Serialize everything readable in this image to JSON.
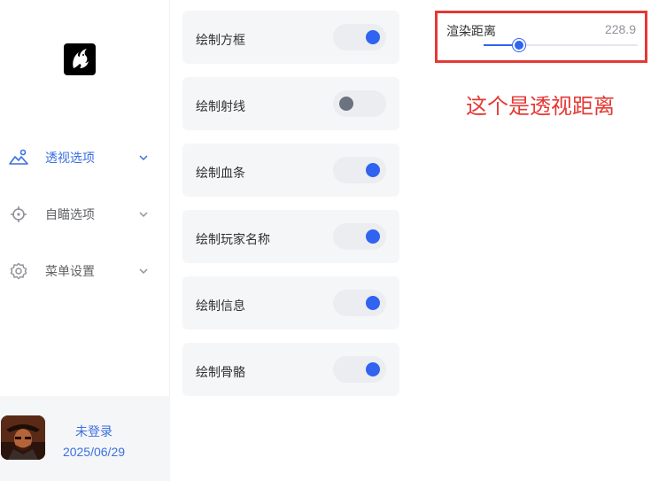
{
  "sidebar": {
    "logo_icon": "dragon-logo-icon",
    "items": [
      {
        "label": "透视选项",
        "icon": "mountain-view-icon",
        "active": true
      },
      {
        "label": "自瞄选项",
        "icon": "crosshair-icon",
        "active": false
      },
      {
        "label": "菜单设置",
        "icon": "gear-icon",
        "active": false
      }
    ],
    "user": {
      "status": "未登录",
      "date": "2025/06/29"
    }
  },
  "toggles": [
    {
      "label": "绘制方框",
      "on": true
    },
    {
      "label": "绘制射线",
      "on": false
    },
    {
      "label": "绘制血条",
      "on": true
    },
    {
      "label": "绘制玩家名称",
      "on": true
    },
    {
      "label": "绘制信息",
      "on": true
    },
    {
      "label": "绘制骨骼",
      "on": true
    }
  ],
  "slider": {
    "label": "渲染距离",
    "value": "228.9",
    "fill_fraction": 0.23
  },
  "annotation": "这个是透视距离",
  "colors": {
    "accent": "#2f63f0",
    "annotation_red": "#e53935",
    "active_text": "#3b6fe0"
  }
}
